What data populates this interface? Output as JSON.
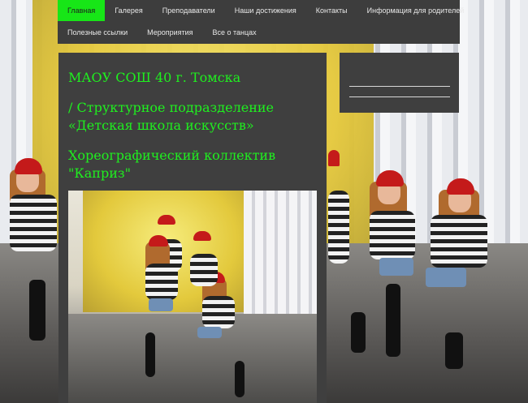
{
  "nav": {
    "items": [
      {
        "label": "Главная",
        "active": true
      },
      {
        "label": "Галерея",
        "active": false
      },
      {
        "label": "Преподаватели",
        "active": false
      },
      {
        "label": "Наши достижения",
        "active": false
      },
      {
        "label": "Контакты",
        "active": false
      },
      {
        "label": "Информация для родителей",
        "active": false
      },
      {
        "label": "Полезные ссылки",
        "active": false
      },
      {
        "label": "Мероприятия",
        "active": false
      },
      {
        "label": "Все о танцах",
        "active": false
      }
    ]
  },
  "main": {
    "school": "МАОУ СОШ 40 г. Томска",
    "division": "/ Структурное подразделение «Детская школа искусств»",
    "collective": "Хореографический коллектив \"Каприз\""
  },
  "colors": {
    "accent": "#17e617",
    "heading": "#1ff01f",
    "panel": "#3f3f3f",
    "nav_bg": "#3d3d3d"
  }
}
